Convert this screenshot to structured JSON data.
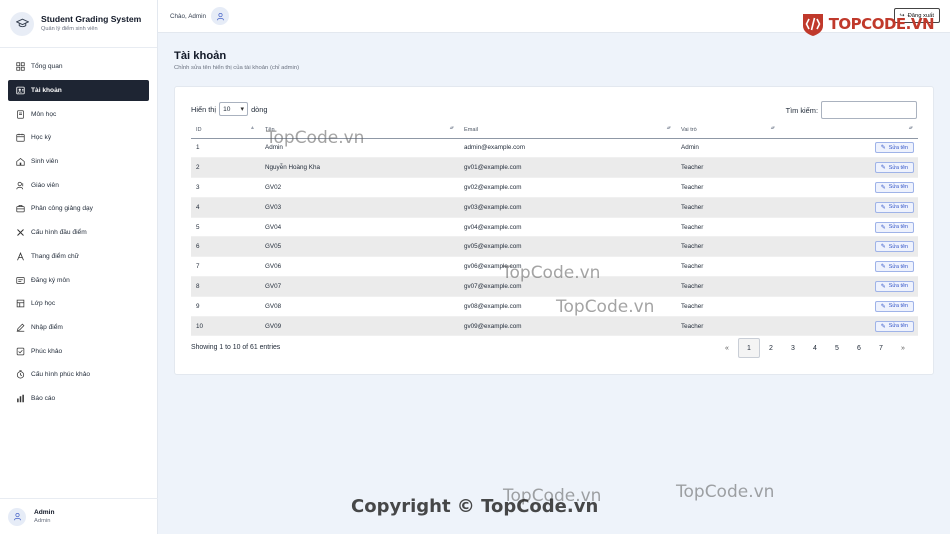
{
  "app": {
    "title": "Student Grading System",
    "subtitle": "Quản lý điểm sinh viên"
  },
  "sidebar": {
    "items": [
      {
        "label": "Tổng quan",
        "icon": "dashboard-icon",
        "active": false
      },
      {
        "label": "Tài khoản",
        "icon": "account-icon",
        "active": true
      },
      {
        "label": "Môn học",
        "icon": "book-icon",
        "active": false
      },
      {
        "label": "Học kỳ",
        "icon": "calendar-icon",
        "active": false
      },
      {
        "label": "Sinh viên",
        "icon": "students-icon",
        "active": false
      },
      {
        "label": "Giáo viên",
        "icon": "teacher-icon",
        "active": false
      },
      {
        "label": "Phân công giảng dạy",
        "icon": "briefcase-icon",
        "active": false
      },
      {
        "label": "Cấu hình đầu điểm",
        "icon": "tools-icon",
        "active": false
      },
      {
        "label": "Thang điểm chữ",
        "icon": "letter-icon",
        "active": false
      },
      {
        "label": "Đăng ký môn",
        "icon": "register-icon",
        "active": false
      },
      {
        "label": "Lớp học",
        "icon": "class-icon",
        "active": false
      },
      {
        "label": "Nhập điểm",
        "icon": "pencil-icon",
        "active": false
      },
      {
        "label": "Phúc khảo",
        "icon": "checklist-icon",
        "active": false
      },
      {
        "label": "Cấu hình phúc khảo",
        "icon": "timer-icon",
        "active": false
      },
      {
        "label": "Báo cáo",
        "icon": "chart-icon",
        "active": false
      }
    ]
  },
  "user": {
    "name": "Admin",
    "role": "Admin"
  },
  "topbar": {
    "greeting": "Chào, Admin",
    "logout": "Đăng xuất"
  },
  "page": {
    "title": "Tài khoản",
    "subtitle": "Chỉnh sửa tên hiển thị của tài khoản (chỉ admin)"
  },
  "table_controls": {
    "show_label": "Hiển thị",
    "page_size": "10",
    "rows_label": "dòng",
    "search_label": "Tìm kiếm:",
    "search_value": ""
  },
  "table": {
    "headers": [
      "ID",
      "Tên",
      "Email",
      "Vai trò",
      ""
    ],
    "rows": [
      {
        "id": "1",
        "name": "Admin",
        "email": "admin@example.com",
        "role": "Admin"
      },
      {
        "id": "2",
        "name": "Nguyễn Hoàng Kha",
        "email": "gv01@example.com",
        "role": "Teacher"
      },
      {
        "id": "3",
        "name": "GV02",
        "email": "gv02@example.com",
        "role": "Teacher"
      },
      {
        "id": "4",
        "name": "GV03",
        "email": "gv03@example.com",
        "role": "Teacher"
      },
      {
        "id": "5",
        "name": "GV04",
        "email": "gv04@example.com",
        "role": "Teacher"
      },
      {
        "id": "6",
        "name": "GV05",
        "email": "gv05@example.com",
        "role": "Teacher"
      },
      {
        "id": "7",
        "name": "GV06",
        "email": "gv06@example.com",
        "role": "Teacher"
      },
      {
        "id": "8",
        "name": "GV07",
        "email": "gv07@example.com",
        "role": "Teacher"
      },
      {
        "id": "9",
        "name": "GV08",
        "email": "gv08@example.com",
        "role": "Teacher"
      },
      {
        "id": "10",
        "name": "GV09",
        "email": "gv09@example.com",
        "role": "Teacher"
      }
    ],
    "edit_label": "Sửa tên"
  },
  "footer": {
    "info": "Showing 1 to 10 of 61 entries",
    "pages": [
      "1",
      "2",
      "3",
      "4",
      "5",
      "6",
      "7"
    ],
    "current_page": "1",
    "prev": "«",
    "next": "»"
  },
  "watermarks": {
    "brand": "TOPCODE.VN",
    "text": "TopCode.vn",
    "copyright": "Copyright © TopCode.vn"
  },
  "colors": {
    "sidebar_active_bg": "#1e2533",
    "page_bg": "#eef3fa",
    "edit_button": "#3456c8",
    "brand_red": "#c0392b"
  }
}
